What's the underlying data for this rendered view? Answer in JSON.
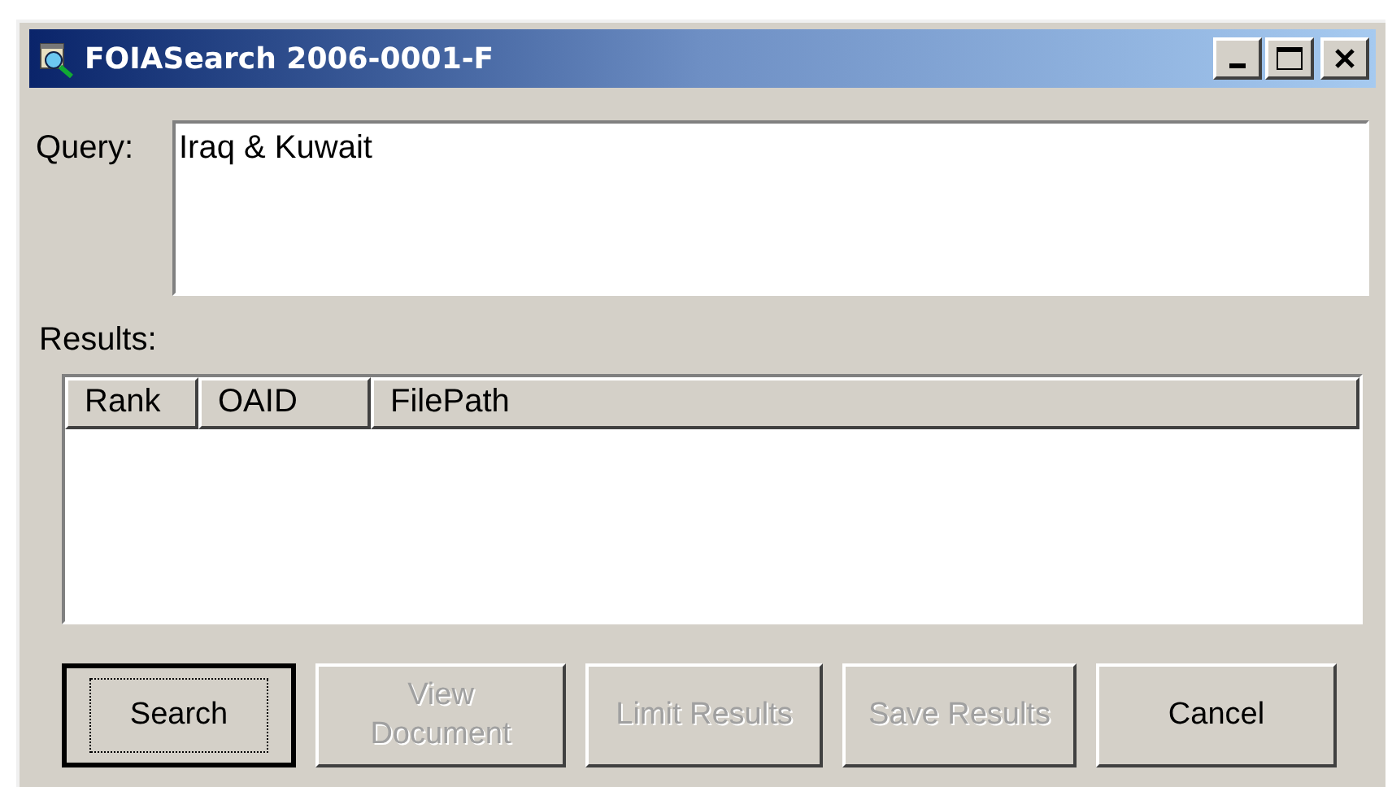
{
  "window": {
    "title": "FOIASearch 2006-0001-F"
  },
  "query": {
    "label": "Query:",
    "value": "Iraq & Kuwait"
  },
  "results": {
    "label": "Results:",
    "columns": [
      "Rank",
      "OAID",
      "FilePath"
    ]
  },
  "buttons": [
    {
      "label": "Search",
      "disabled": false,
      "default": true
    },
    {
      "label": "View Document",
      "disabled": true,
      "default": false
    },
    {
      "label": "Limit Results",
      "disabled": true,
      "default": false
    },
    {
      "label": "Save Results",
      "disabled": true,
      "default": false
    },
    {
      "label": "Cancel",
      "disabled": false,
      "default": false
    }
  ]
}
